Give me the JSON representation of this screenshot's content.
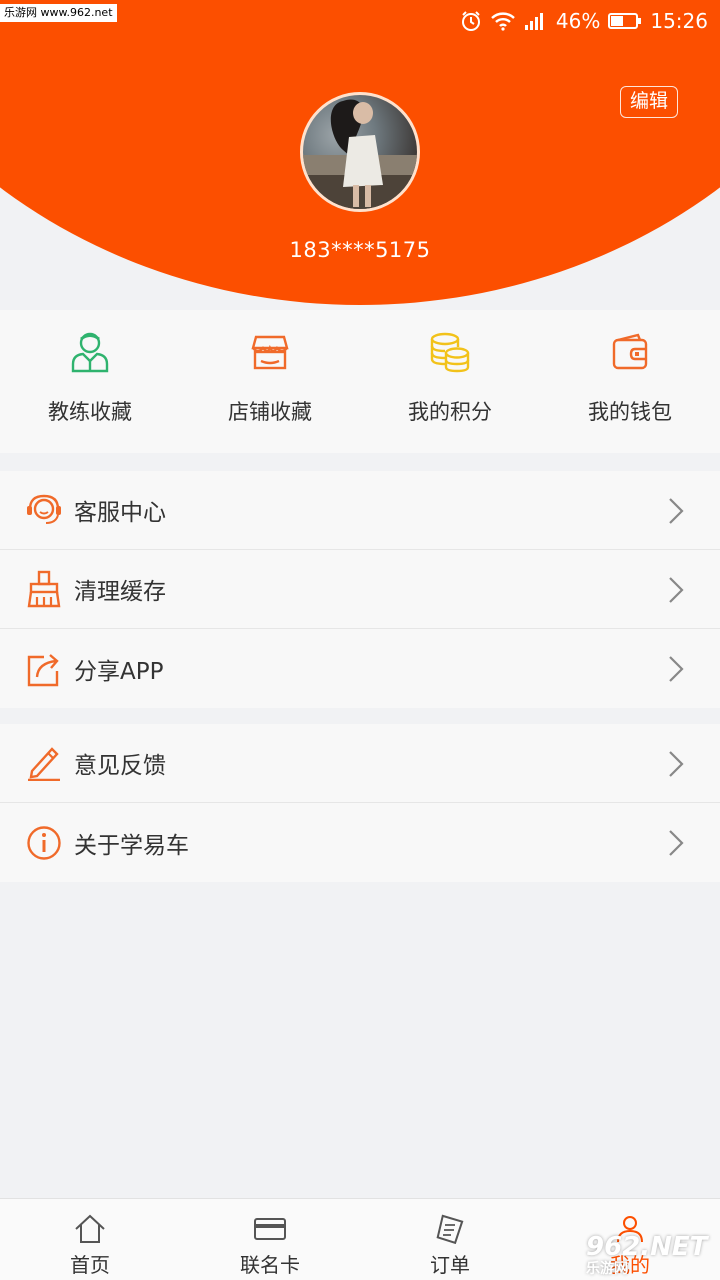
{
  "watermark_top": "乐游网 www.962.net",
  "status_bar": {
    "battery": "46%",
    "time": "15:26"
  },
  "header": {
    "edit_label": "编辑",
    "phone": "183****5175"
  },
  "quick_actions": [
    {
      "label": "教练收藏",
      "icon": "coach-icon",
      "color": "#2fb36e"
    },
    {
      "label": "店铺收藏",
      "icon": "store-icon",
      "color": "#f06a2a"
    },
    {
      "label": "我的积分",
      "icon": "coins-icon",
      "color": "#f2c21a"
    },
    {
      "label": "我的钱包",
      "icon": "wallet-icon",
      "color": "#f06a2a"
    }
  ],
  "menu_group_1": [
    {
      "label": "客服中心",
      "icon": "headset-icon"
    },
    {
      "label": "清理缓存",
      "icon": "broom-icon"
    },
    {
      "label": "分享APP",
      "icon": "share-icon"
    }
  ],
  "menu_group_2": [
    {
      "label": "意见反馈",
      "icon": "pencil-icon"
    },
    {
      "label": "关于学易车",
      "icon": "info-icon"
    }
  ],
  "bottom_nav": [
    {
      "label": "首页",
      "icon": "home-icon"
    },
    {
      "label": "联名卡",
      "icon": "card-icon"
    },
    {
      "label": "订单",
      "icon": "order-icon"
    },
    {
      "label": "我的",
      "icon": "user-icon",
      "active": true
    }
  ],
  "watermark_bottom": {
    "main": "962.NET",
    "sub": "乐游网"
  },
  "colors": {
    "brand": "#fc4f00",
    "icon_orange": "#f06a2a",
    "icon_green": "#2fb36e",
    "icon_gold": "#f2c21a"
  }
}
